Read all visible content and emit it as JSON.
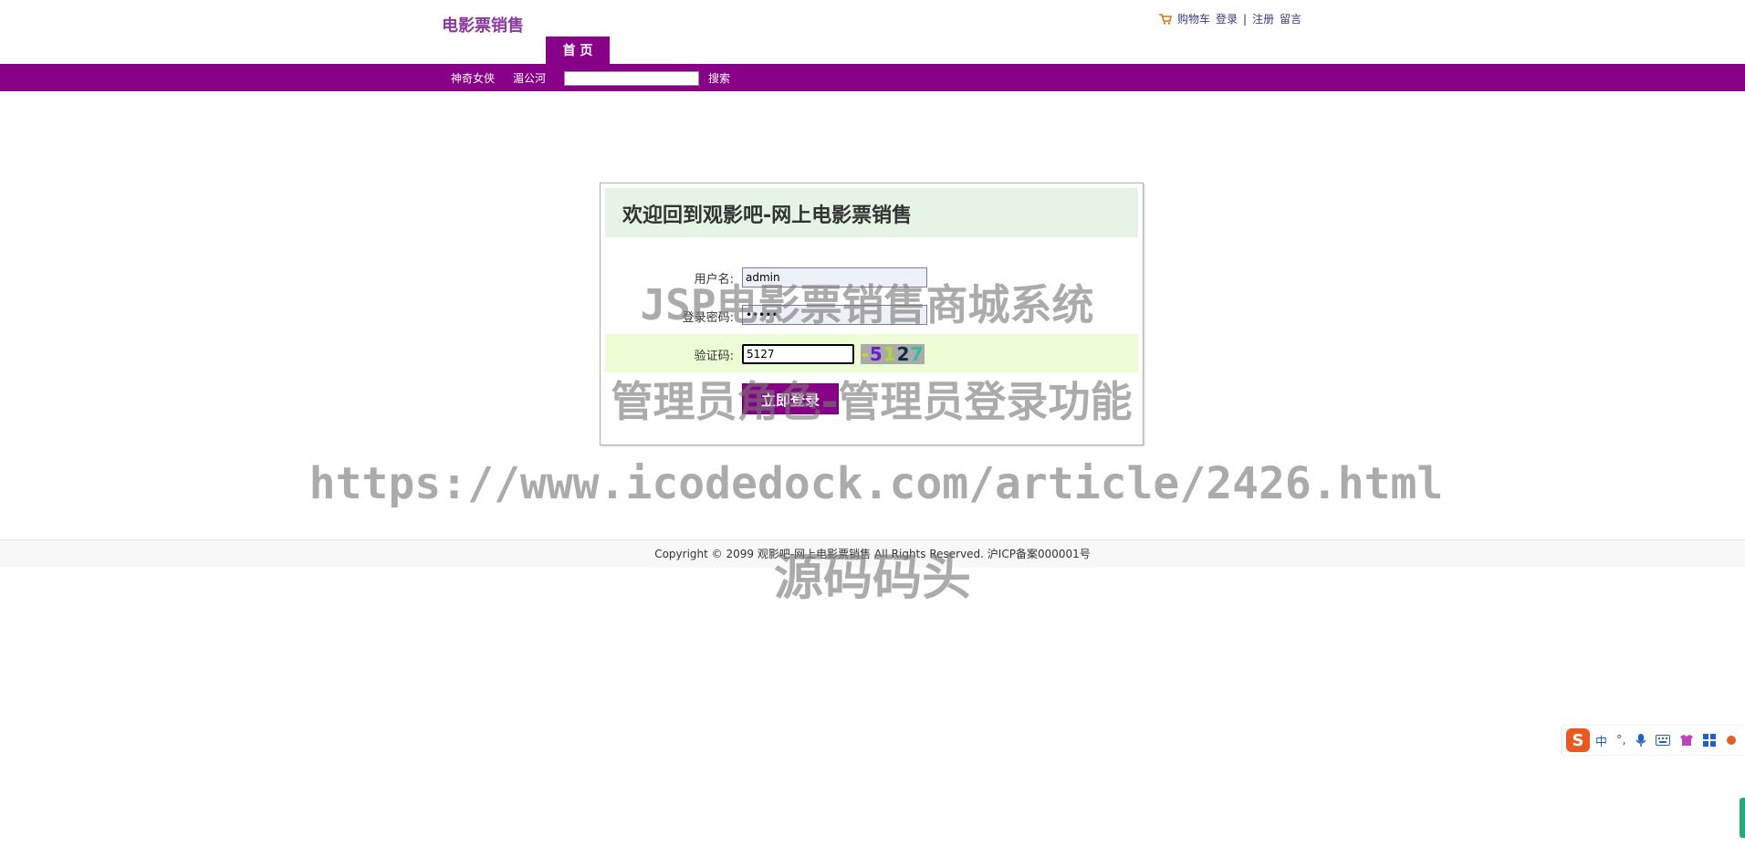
{
  "header": {
    "site_title": "电影票销售",
    "top_links": {
      "cart": "购物车",
      "login": "登录",
      "separator": "|",
      "register": "注册",
      "message": "留言"
    },
    "nav_tab": "首 页"
  },
  "nav": {
    "links": [
      "神奇女侠",
      "湄公河"
    ],
    "search_value": "",
    "search_button": "搜索"
  },
  "login": {
    "title": "欢迎回到观影吧-网上电影票销售",
    "username_label": "用户名:",
    "username_value": "admin",
    "password_label": "登录密码:",
    "password_value": "•••••",
    "captcha_label": "验证码:",
    "captcha_value": "5127",
    "captcha_image_text": [
      "-",
      "5",
      "1",
      "2",
      "7"
    ],
    "submit_label": "立即登录"
  },
  "footer": {
    "copyright": "Copyright © 2099 观影吧-网上电影票销售 All Rights Reserved. 沪ICP备案000001号"
  },
  "watermark": {
    "line1": "JSP电影票销售商城系统",
    "line2": "管理员角色-管理员登录功能",
    "line3": "https://www.icodedock.com/article/2426.html",
    "line4": "源码码头"
  },
  "ime": {
    "logo": "S",
    "mode": "中",
    "punct": "°,",
    "icons": [
      "mic-icon",
      "keyboard-icon",
      "skin-icon",
      "grid-icon",
      "tools-icon"
    ]
  },
  "colors": {
    "accent": "#880088",
    "title": "#8b3aa0",
    "login_head_bg": "#e6f4e6",
    "captcha_row_bg": "#ecfcd4"
  }
}
